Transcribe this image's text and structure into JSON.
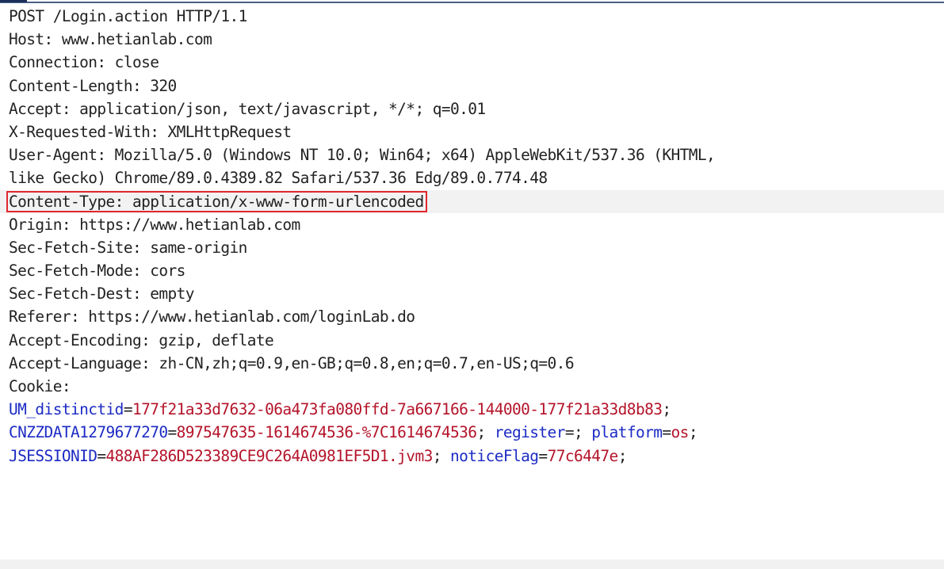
{
  "request": {
    "lines": [
      "POST /Login.action HTTP/1.1",
      "Host: www.hetianlab.com",
      "Connection: close",
      "Content-Length: 320",
      "Accept: application/json, text/javascript, */*; q=0.01",
      "X-Requested-With: XMLHttpRequest",
      "User-Agent: Mozilla/5.0 (Windows NT 10.0; Win64; x64) AppleWebKit/537.36 (KHTML,",
      "like Gecko) Chrome/89.0.4389.82 Safari/537.36 Edg/89.0.774.48"
    ],
    "highlighted_line": "Content-Type: application/x-www-form-urlencoded",
    "lines_after": [
      "Origin: https://www.hetianlab.com",
      "Sec-Fetch-Site: same-origin",
      "Sec-Fetch-Mode: cors",
      "Sec-Fetch-Dest: empty",
      "Referer: https://www.hetianlab.com/loginLab.do",
      "Accept-Encoding: gzip, deflate",
      "Accept-Language: zh-CN,zh;q=0.9,en-GB;q=0.8,en;q=0.7,en-US;q=0.6",
      "Cookie:"
    ],
    "cookies": {
      "line1": {
        "k1": "UM_distinctid",
        "eq1": "=",
        "v1": "177f21a33d7632-06a473fa080ffd-7a667166-144000-177f21a33d8b83",
        "sep1": ";"
      },
      "line2": {
        "k1": "CNZZDATA1279677270",
        "eq1": "=",
        "v1": "897547635-1614674536-%7C1614674536",
        "sep1": "; ",
        "k2": "register",
        "eq2": "=",
        "sep2": "; ",
        "k3": "platform",
        "eq3": "=",
        "v3": "os",
        "sep3": ";"
      },
      "line3": {
        "k1": "JSESSIONID",
        "eq1": "=",
        "v1": "488AF286D523389CE9C264A0981EF5D1.jvm3",
        "sep1": "; ",
        "k2": "noticeFlag",
        "eq2": "=",
        "v2": "77c6447e",
        "sep2": ";"
      }
    }
  },
  "colors": {
    "key": "#1c2bc4",
    "value": "#b4142a",
    "text": "#222222",
    "highlight_box": "#e0282e"
  }
}
